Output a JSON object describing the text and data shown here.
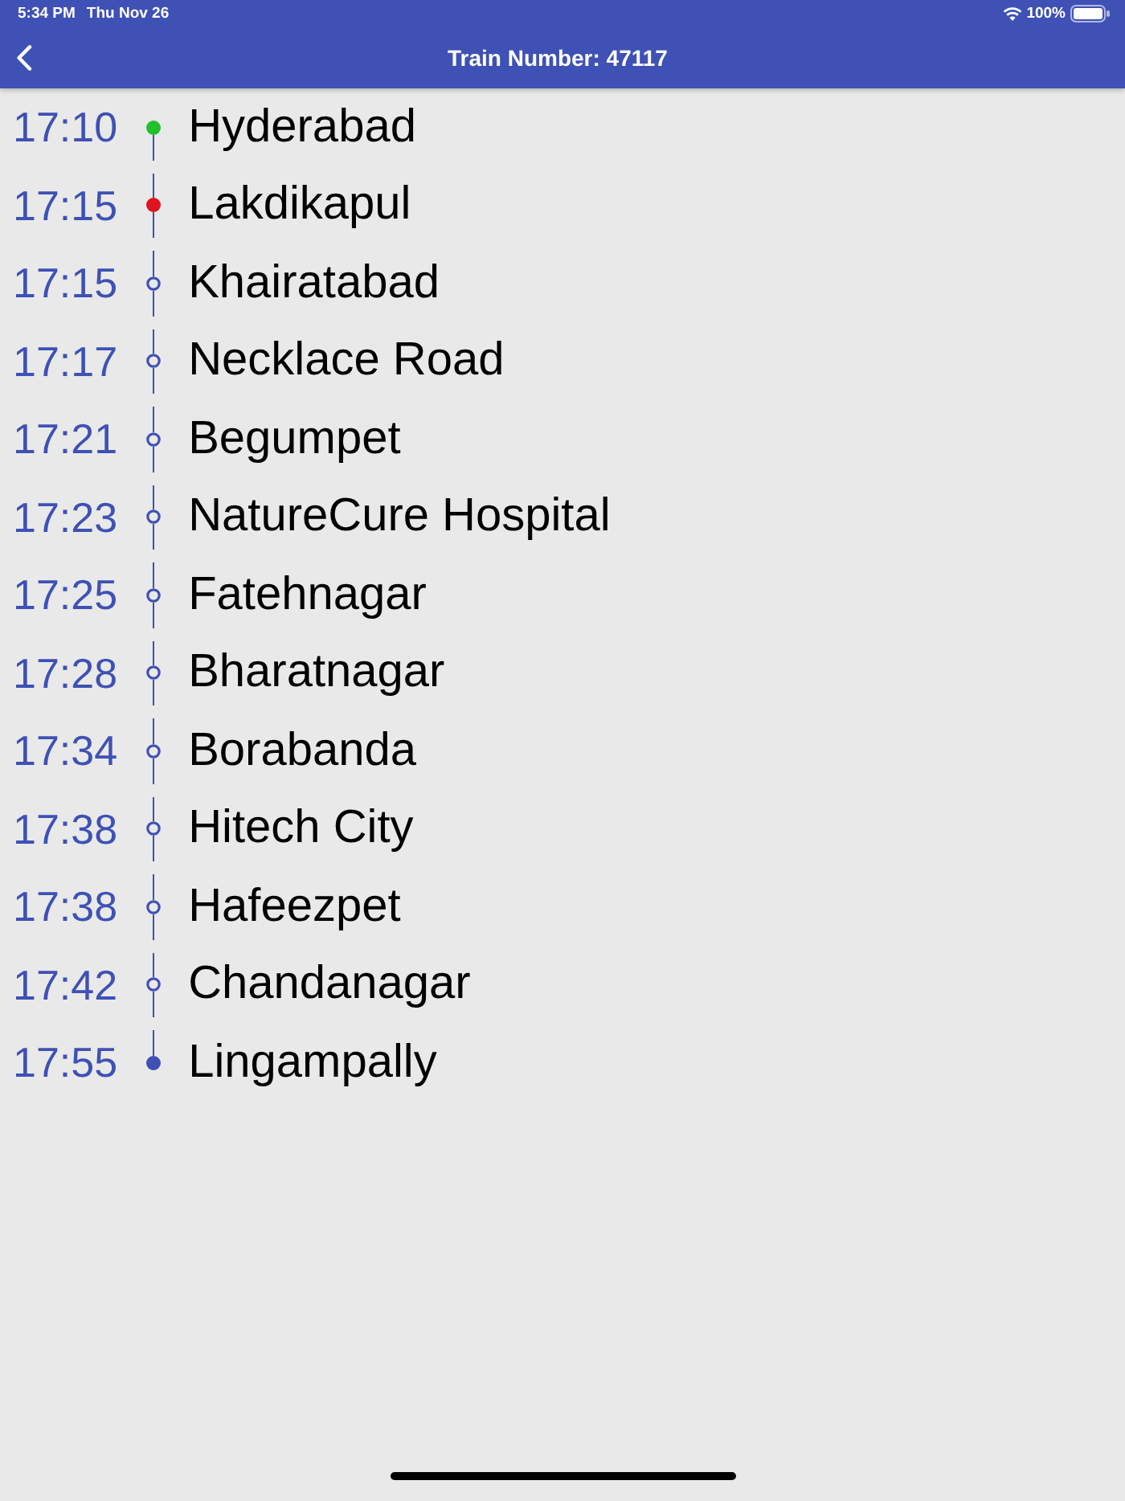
{
  "status_bar": {
    "time": "5:34 PM",
    "date": "Thu Nov 26",
    "battery": "100%"
  },
  "header": {
    "title": "Train Number: 47117"
  },
  "stops": [
    {
      "time": "17:10",
      "station": "Hyderabad",
      "kind": "filled",
      "color": "#22c02a"
    },
    {
      "time": "17:15",
      "station": "Lakdikapul",
      "kind": "filled",
      "color": "#e0141e"
    },
    {
      "time": "17:15",
      "station": "Khairatabad",
      "kind": "hollow",
      "color": "#3f51b5"
    },
    {
      "time": "17:17",
      "station": "Necklace Road",
      "kind": "hollow",
      "color": "#3f51b5"
    },
    {
      "time": "17:21",
      "station": "Begumpet",
      "kind": "hollow",
      "color": "#3f51b5"
    },
    {
      "time": "17:23",
      "station": "NatureCure Hospital",
      "kind": "hollow",
      "color": "#3f51b5"
    },
    {
      "time": "17:25",
      "station": "Fatehnagar",
      "kind": "hollow",
      "color": "#3f51b5"
    },
    {
      "time": "17:28",
      "station": "Bharatnagar",
      "kind": "hollow",
      "color": "#3f51b5"
    },
    {
      "time": "17:34",
      "station": "Borabanda",
      "kind": "hollow",
      "color": "#3f51b5"
    },
    {
      "time": "17:38",
      "station": "Hitech City",
      "kind": "hollow",
      "color": "#3f51b5"
    },
    {
      "time": "17:38",
      "station": "Hafeezpet",
      "kind": "hollow",
      "color": "#3f51b5"
    },
    {
      "time": "17:42",
      "station": "Chandanagar",
      "kind": "hollow",
      "color": "#3f51b5"
    },
    {
      "time": "17:55",
      "station": "Lingampally",
      "kind": "filled",
      "color": "#3f51b5"
    }
  ]
}
